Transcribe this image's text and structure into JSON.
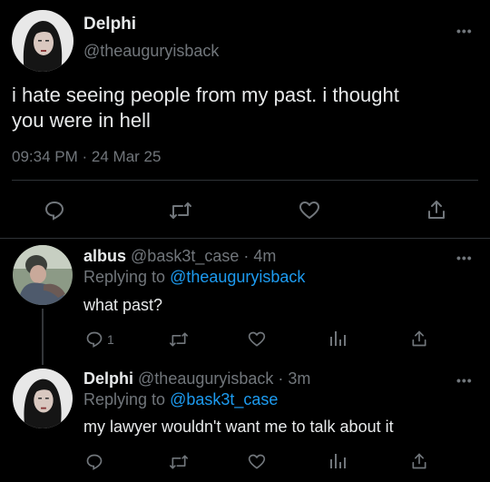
{
  "main_tweet": {
    "name": "Delphi",
    "handle": "@theauguryisback",
    "text_line1": "i hate seeing people from my past. i thought",
    "text_line2": "you were in hell",
    "time": "09:34 PM",
    "sep": "·",
    "date": "24 Mar 25",
    "more": "•••"
  },
  "reply1": {
    "name": "albus",
    "handle": "@bask3t_case",
    "sep": "·",
    "time": "4m",
    "replying_prefix": "Replying to",
    "replying_to": "@theauguryisback",
    "text": "what past?",
    "reply_count": "1",
    "more": "•••"
  },
  "reply2": {
    "name": "Delphi",
    "handle": "@theauguryisback",
    "sep": "·",
    "time": "3m",
    "replying_prefix": "Replying to",
    "replying_to": "@bask3t_case",
    "text": "my lawyer wouldn't want me to talk about it",
    "more": "•••"
  },
  "colors": {
    "background": "#000000",
    "text": "#e7e9ea",
    "muted": "#71767b",
    "link": "#1d9bf0",
    "divider": "#2f3336"
  },
  "icons": [
    "reply-icon",
    "retweet-icon",
    "like-icon",
    "share-icon",
    "analytics-icon",
    "more-icon"
  ]
}
